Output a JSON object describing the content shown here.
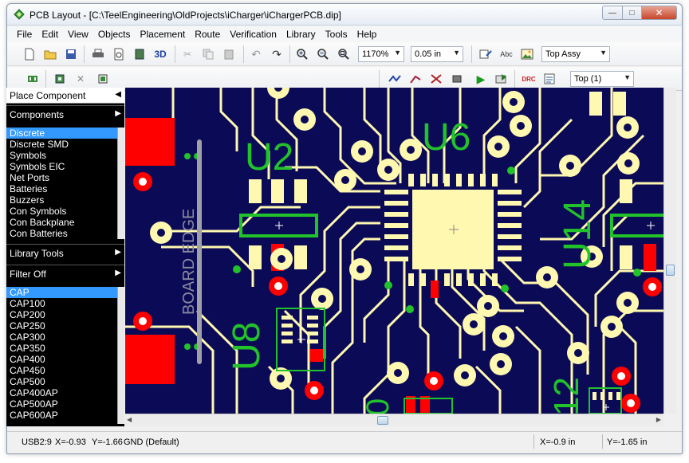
{
  "window": {
    "title": "PCB Layout - [C:\\TeelEngineering\\OldProjects\\iCharger\\iChargerPCB.dip]",
    "controls": {
      "minimize": "—",
      "maximize": "□",
      "close": "✕"
    }
  },
  "menu": [
    "File",
    "Edit",
    "View",
    "Objects",
    "Placement",
    "Route",
    "Verification",
    "Library",
    "Tools",
    "Help"
  ],
  "toolbar": {
    "btn_3d": "3D",
    "zoom_value": "1170%",
    "grid_value": "0.05 in",
    "layer_mode": "Top Assy",
    "active_layer": "Top (1)"
  },
  "left_panel": {
    "place_component": "Place Component",
    "components": "Components",
    "library_items": [
      "Discrete",
      "Discrete SMD",
      "Symbols",
      "Symbols EIC",
      "Net Ports",
      "Batteries",
      "Buzzers",
      "Con Symbols",
      "Con Backplane",
      "Con Batteries"
    ],
    "library_tools": "Library Tools",
    "filter": "Filter Off",
    "parts": [
      "CAP",
      "CAP100",
      "CAP200",
      "CAP250",
      "CAP300",
      "CAP350",
      "CAP400",
      "CAP450",
      "CAP500",
      "CAP400AP",
      "CAP500AP",
      "CAP600AP"
    ]
  },
  "board": {
    "labels": [
      "U2",
      "U6",
      "U14",
      "U8",
      "12",
      "0"
    ],
    "edge_label": "BOARD EDGE",
    "colors": {
      "background": "#0b0a57",
      "copper": "#fff8b0",
      "silk": "#22c22a",
      "red_pad": "#ff0000",
      "white": "#ffffff",
      "edge": "#a0a0a8"
    }
  },
  "status": {
    "net": "USB2:9",
    "x": "X=-0.93",
    "y": "Y=-1.66",
    "layer": "GND (Default)",
    "cursor_x": "X=-0.9 in",
    "cursor_y": "Y=-1.65 in"
  }
}
